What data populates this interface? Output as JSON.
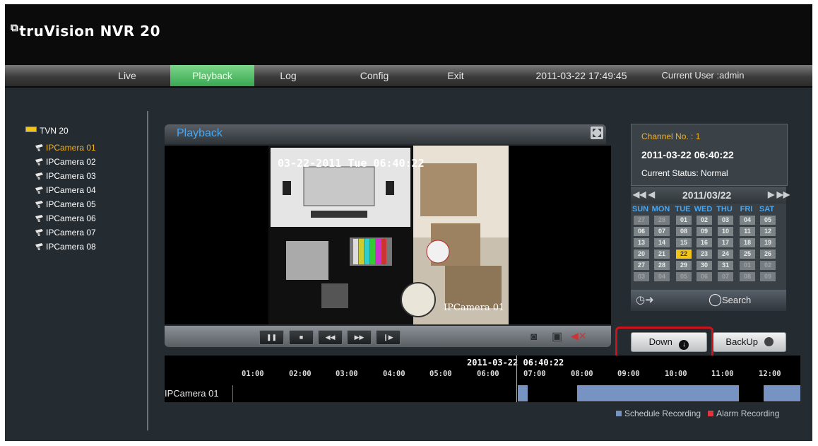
{
  "app": {
    "title_prefix": "truVision",
    "title_model": "NVR 20"
  },
  "nav": {
    "items": [
      {
        "label": "Live"
      },
      {
        "label": "Playback"
      },
      {
        "label": "Log"
      },
      {
        "label": "Config"
      },
      {
        "label": "Exit"
      }
    ],
    "active": "Playback",
    "datetime": "2011-03-22 17:49:45",
    "current_user": "Current User :admin"
  },
  "tree": {
    "root": "TVN 20",
    "cameras": [
      "IPCamera 01",
      "IPCamera 02",
      "IPCamera 03",
      "IPCamera 04",
      "IPCamera 05",
      "IPCamera 06",
      "IPCamera 07",
      "IPCamera 08"
    ],
    "selected": "IPCamera 01"
  },
  "playback": {
    "title": "Playback",
    "overlay_time": "03-22-2011 Tue 06:40:22",
    "overlay_camera": "IPCamera 01"
  },
  "info": {
    "channel": "Channel No. : 1",
    "datetime": "2011-03-22 06:40:22",
    "status": "Current Status: Normal"
  },
  "calendar": {
    "month_label": "2011/03/22",
    "weekdays": [
      "SUN",
      "MON",
      "TUE",
      "WED",
      "THU",
      "FRI",
      "SAT"
    ],
    "weeks": [
      [
        "27",
        "28",
        "01",
        "02",
        "03",
        "04",
        "05"
      ],
      [
        "06",
        "07",
        "08",
        "09",
        "10",
        "11",
        "12"
      ],
      [
        "13",
        "14",
        "15",
        "16",
        "17",
        "18",
        "19"
      ],
      [
        "20",
        "21",
        "22",
        "23",
        "24",
        "25",
        "26"
      ],
      [
        "27",
        "28",
        "29",
        "30",
        "31",
        "01",
        "02"
      ],
      [
        "03",
        "04",
        "05",
        "06",
        "07",
        "08",
        "09"
      ]
    ],
    "today": "22",
    "search_label": "Search"
  },
  "buttons": {
    "down": "Down",
    "backup": "BackUp"
  },
  "timeline": {
    "current_time": "2011-03-22 06:40:22",
    "ticks": [
      "01:00",
      "02:00",
      "03:00",
      "04:00",
      "05:00",
      "06:00",
      "07:00",
      "08:00",
      "09:00",
      "10:00",
      "11:00",
      "12:00"
    ],
    "channel_label": "IPCamera 01",
    "legend": {
      "schedule": "Schedule Recording",
      "alarm": "Alarm Recording"
    },
    "colors": {
      "schedule": "#7793c2",
      "alarm": "#e0353a",
      "cursor": "#d7b24a"
    }
  },
  "colors": {
    "accent": "#4aa6ef",
    "selected": "#f2b01e",
    "active_tab": "#3aa852",
    "highlight": "#c8141c"
  }
}
